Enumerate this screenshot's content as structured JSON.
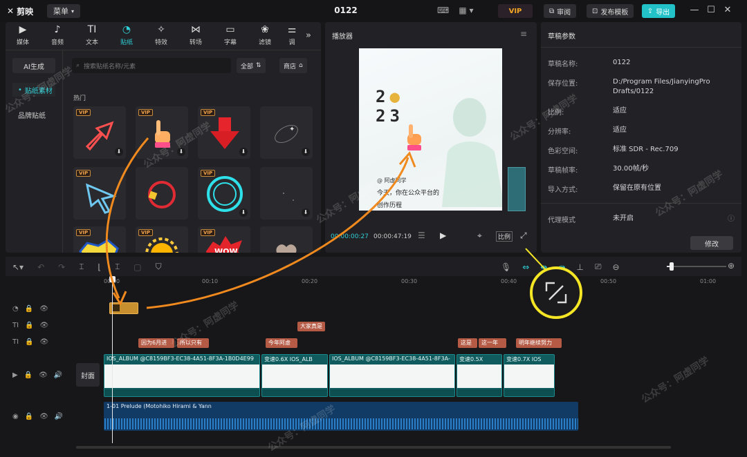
{
  "titlebar": {
    "app_name": "剪映",
    "menu_label": "菜单",
    "project_title": "0122",
    "vip_label": "VIP",
    "review_label": "审阅",
    "publish_label": "发布模板",
    "export_label": "导出"
  },
  "media": {
    "tabs": [
      {
        "label": "媒体",
        "icon": "media-icon"
      },
      {
        "label": "音频",
        "icon": "audio-icon"
      },
      {
        "label": "文本",
        "icon": "text-icon"
      },
      {
        "label": "贴纸",
        "icon": "sticker-icon"
      },
      {
        "label": "特效",
        "icon": "effect-icon"
      },
      {
        "label": "转场",
        "icon": "transition-icon"
      },
      {
        "label": "字幕",
        "icon": "caption-icon"
      },
      {
        "label": "滤镜",
        "icon": "filter-icon"
      },
      {
        "label": "调",
        "icon": "adjust-icon"
      }
    ],
    "side": {
      "ai": "AI生成",
      "items": [
        "贴纸素材",
        "品牌贴纸"
      ]
    },
    "search_placeholder": "搜索贴纸名称/元素",
    "filter_all": "全部",
    "store_label": "商店",
    "section": "热门",
    "vip_tag": "VIP",
    "stickers": [
      {
        "icon": "outline-arrow-icon",
        "vip": true
      },
      {
        "icon": "pointing-hand-icon",
        "vip": true
      },
      {
        "icon": "red-down-arrow-icon",
        "vip": true
      },
      {
        "icon": "sparkle-orbit-icon",
        "vip": false
      },
      {
        "icon": "cursor-arrow-icon",
        "vip": true
      },
      {
        "icon": "red-ring-icon",
        "vip": false
      },
      {
        "icon": "cyan-ring-icon",
        "vip": true
      },
      {
        "icon": "dark-sparkle-icon",
        "vip": false
      },
      {
        "icon": "comic-burst-icon",
        "vip": true
      },
      {
        "icon": "sun-face-icon",
        "vip": true
      },
      {
        "icon": "wow-burst-icon",
        "vip": true
      },
      {
        "icon": "heart-icon",
        "vip": false
      }
    ]
  },
  "player": {
    "title": "播放器",
    "video": {
      "year_top": "2",
      "year_top2": "",
      "year_bottom": "23",
      "handle": "@ 阿虚同学",
      "line1": "今天，你在公众平台的",
      "line2": "创作历程"
    },
    "time_current": "00:00:00:27",
    "time_total": "00:00:47:19",
    "ratio_label": "比例"
  },
  "params": {
    "title": "草稿参数",
    "rows": [
      {
        "label": "草稿名称:",
        "value": "0122"
      },
      {
        "label": "保存位置:",
        "value": "D:/Program Files/JianyingPro Drafts/0122"
      },
      {
        "label": "比例:",
        "value": "适应"
      },
      {
        "label": "分辨率:",
        "value": "适应"
      },
      {
        "label": "色彩空间:",
        "value": "标准 SDR - Rec.709"
      },
      {
        "label": "草稿帧率:",
        "value": "30.00帧/秒"
      },
      {
        "label": "导入方式:",
        "value": "保留在原有位置"
      },
      {
        "label": "代理模式",
        "value": "未开启"
      }
    ],
    "edit_label": "修改"
  },
  "timeline": {
    "ticks": [
      "00:00",
      "00:10",
      "00:20",
      "00:30",
      "00:40",
      "00:50",
      "01:00"
    ],
    "cover_label": "封面",
    "text_clips_row1": [
      "大家真是"
    ],
    "text_clips_row2": [
      "因为6月进",
      "所以只有",
      "今年阿虚",
      "这是",
      "这一年",
      "明年继续努力"
    ],
    "video_clips": [
      {
        "label": "IOS_ALBUM @C8159BF3-EC38-4A51-8F3A-1B0D4E99"
      },
      {
        "label": "变速0.6X IOS_ALB"
      },
      {
        "label": "IOS_ALBUM @C8159BF3-EC38-4A51-8F3A-"
      },
      {
        "label": "变速0.5X"
      },
      {
        "label": "变速0.7X IOS"
      }
    ],
    "audio_label": "1-01 Prelude (Motohiko Hirami & Yann"
  },
  "watermark": "公众号：阿虚同学",
  "colors": {
    "accent": "#2fd0d7",
    "annotation": "#f08a1e",
    "highlight": "#f5e625"
  }
}
